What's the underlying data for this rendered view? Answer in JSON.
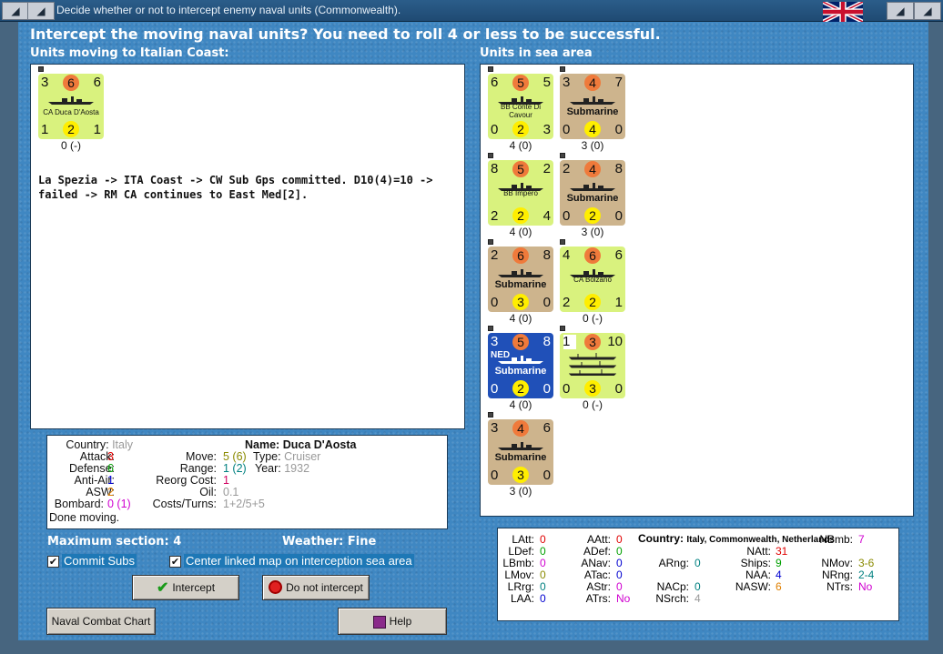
{
  "window": {
    "title": "Decide whether or not to intercept enemy naval units (Commonwealth)."
  },
  "heading": "Intercept the moving naval units?  You need to roll 4 or less to be successful.",
  "moving_label": "Units moving to Italian Coast:",
  "sea_label": "Units in sea area",
  "moving_unit": {
    "tl": "3",
    "att": "6",
    "tr": "6",
    "name": "CA Duca D'Aosta",
    "bl": "1",
    "def": "2",
    "br": "1",
    "caption": "0 (-)"
  },
  "combat_text": "La Spezia -> ITA Coast -> CW Sub Gps committed.  D10(4)=10 -> failed  -> RM CA continues to East Med[2].",
  "sea_units": [
    {
      "tl": "6",
      "att": "5",
      "tr": "5",
      "name": "BB Conte Di Cavour",
      "bl": "0",
      "def": "2",
      "br": "3",
      "caption": "4 (0)"
    },
    {
      "tl": "3",
      "att": "4",
      "tr": "7",
      "name": "Submarine",
      "bl": "0",
      "def": "4",
      "br": "0",
      "caption": "3 (0)"
    },
    {
      "tl": "8",
      "att": "5",
      "tr": "2",
      "name": "BB Impero",
      "bl": "2",
      "def": "2",
      "br": "4",
      "caption": "4 (0)"
    },
    {
      "tl": "2",
      "att": "4",
      "tr": "8",
      "name": "Submarine",
      "bl": "0",
      "def": "2",
      "br": "0",
      "caption": "3 (0)"
    },
    {
      "tl": "2",
      "att": "6",
      "tr": "8",
      "name": "Submarine",
      "bl": "0",
      "def": "3",
      "br": "0",
      "caption": "4 (0)"
    },
    {
      "tl": "4",
      "att": "6",
      "tr": "6",
      "name": "CA Bolzano",
      "bl": "2",
      "def": "2",
      "br": "1",
      "caption": "0 (-)"
    },
    {
      "tl": "3",
      "att": "5",
      "tr": "8",
      "name": "Submarine",
      "nation": "NED",
      "bl": "0",
      "def": "2",
      "br": "0",
      "caption": "4 (0)"
    },
    {
      "tl": "1",
      "att": "3",
      "tr": "10",
      "name": "",
      "bl": "0",
      "def": "3",
      "br": "0",
      "caption": "0 (-)"
    },
    {
      "tl": "3",
      "att": "4",
      "tr": "6",
      "name": "Submarine",
      "bl": "0",
      "def": "3",
      "br": "0",
      "caption": "3 (0)"
    }
  ],
  "info": {
    "country_label": "Country:",
    "country": "Italy",
    "attack_label": "Attack:",
    "attack": "3",
    "defense_label": "Defense:",
    "defense": "6",
    "antiair_label": "Anti-Air:",
    "antiair": "1",
    "asw_label": "ASW:",
    "asw": "2",
    "bombard_label": "Bombard:",
    "bombard": "0 (1)",
    "status": "Done moving.",
    "name_label": "Name:",
    "name": "Duca D'Aosta",
    "move_label": "Move:",
    "move": "5 (6)",
    "type_label": "Type:",
    "type": "Cruiser",
    "range_label": "Range:",
    "range": "1 (2)",
    "year_label": "Year:",
    "year": "1932",
    "reorg_label": "Reorg Cost:",
    "reorg": "1",
    "oil_label": "Oil:",
    "oil": "0.1",
    "costs_label": "Costs/Turns:",
    "costs": "1+2/5+5"
  },
  "max_section": "Maximum section: 4",
  "weather": "Weather:  Fine",
  "commit_subs": "Commit Subs",
  "center_map": "Center linked map on interception sea area",
  "buttons": {
    "intercept": "Intercept",
    "no_intercept": "Do not intercept",
    "chart": "Naval Combat Chart",
    "help": "Help"
  },
  "stats": {
    "latt": "LAtt:",
    "latt_v": "0",
    "ldef": "LDef:",
    "ldef_v": "0",
    "lbmb": "LBmb:",
    "lbmb_v": "0",
    "lmov": "LMov:",
    "lmov_v": "0",
    "lrng": "LRrg:",
    "lrng_v": "0",
    "laa": "LAA:",
    "laa_v": "0",
    "aatt": "AAtt:",
    "aatt_v": "0",
    "adef": "ADef:",
    "adef_v": "0",
    "anav": "ANav:",
    "anav_v": "0",
    "atac": "ATac:",
    "atac_v": "0",
    "astr": "AStr:",
    "astr_v": "0",
    "atrs": "ATrs:",
    "atrs_v": "No",
    "country_label": "Country:",
    "country": "Italy, Commonwealth, Netherlands",
    "arng": "ARng:",
    "arng_v": "0",
    "nacp": "NACp:",
    "nacp_v": "0",
    "nsrch": "NSrch:",
    "nsrch_v": "4",
    "natt": "NAtt:",
    "natt_v": "31",
    "ships": "Ships:",
    "ships_v": "9",
    "naa": "NAA:",
    "naa_v": "4",
    "nasw": "NASW:",
    "nasw_v": "6",
    "nbmb": "NBmb:",
    "nbmb_v": "7",
    "nmov": "NMov:",
    "nmov_v": "3-6",
    "nrng": "NRng:",
    "nrng_v": "2-4",
    "ntrs": "NTrs:",
    "ntrs_v": "No"
  }
}
